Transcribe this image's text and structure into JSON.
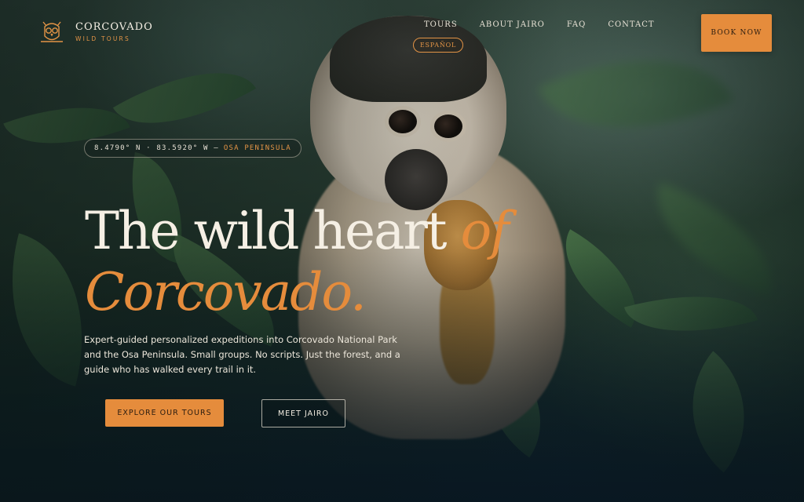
{
  "brand": {
    "name": "CORCOVADO",
    "tagline": "WILD TOURS",
    "logo_icon": "owl-icon",
    "accent_color": "#e58c3c"
  },
  "nav": {
    "items": [
      {
        "label": "TOURS"
      },
      {
        "label": "ABOUT JAIRO"
      },
      {
        "label": "FAQ"
      },
      {
        "label": "CONTACT"
      }
    ],
    "language_toggle": "ESPAÑOL",
    "book_button": "BOOK NOW"
  },
  "hero": {
    "coordinates": "8.4790° N · 83.5920° W —",
    "location": "OSA PENINSULA",
    "headline_part1": "The wild heart ",
    "headline_accent1": "of",
    "headline_accent2": "Corcovado.",
    "description": "Expert-guided personalized expeditions into Corcovado National Park and the Osa Peninsula. Small groups. No scripts. Just the forest, and a guide who has walked every trail in it.",
    "primary_cta": "EXPLORE OUR TOURS",
    "secondary_cta": "MEET JAIRO"
  }
}
